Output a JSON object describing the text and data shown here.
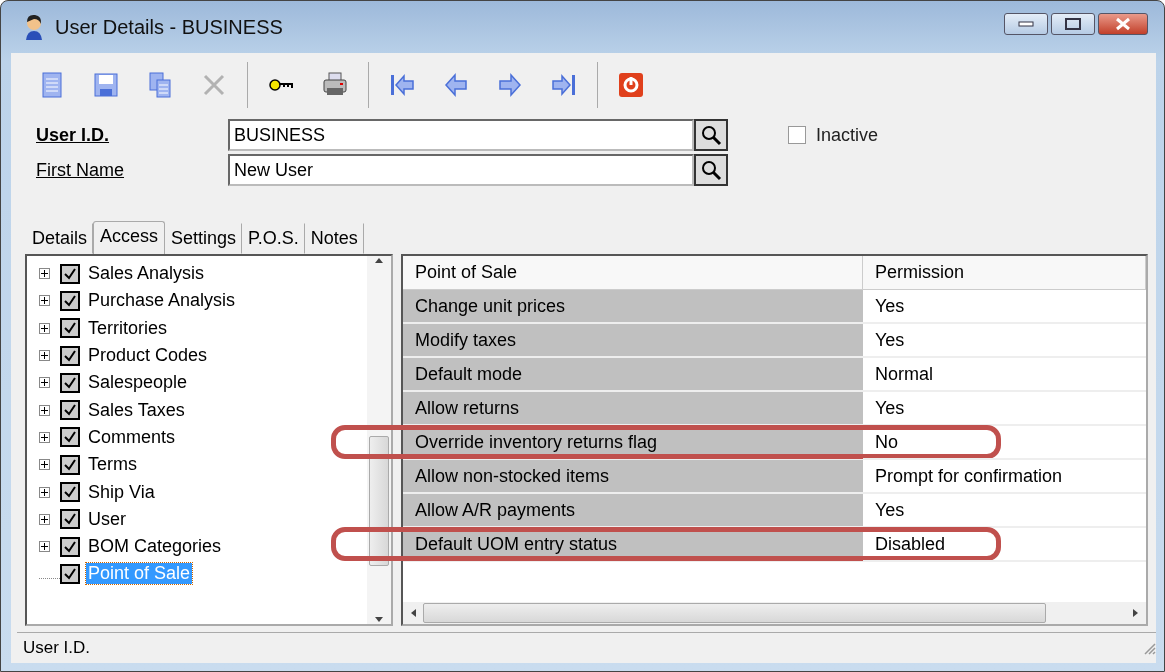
{
  "window": {
    "title": "User Details - BUSINESS"
  },
  "toolbar": [
    {
      "disabled": false
    },
    {
      "disabled": false
    },
    {
      "disabled": false
    },
    {
      "disabled": true
    },
    {
      "disabled": false
    },
    {
      "disabled": false
    },
    {
      "disabled": false
    },
    {
      "disabled": false
    },
    {
      "disabled": false
    },
    {
      "disabled": false
    },
    {
      "disabled": false
    }
  ],
  "fields": [
    {
      "label": "User I.D.",
      "value": "BUSINESS",
      "bold": true
    },
    {
      "label": "First Name",
      "value": "New User",
      "bold": false
    }
  ],
  "inactive": {
    "label": "Inactive",
    "checked": false
  },
  "tabs": [
    {
      "label": "Details",
      "selected": false
    },
    {
      "label": "Access",
      "selected": true
    },
    {
      "label": "Settings",
      "selected": false
    },
    {
      "label": "P.O.S.",
      "selected": false
    },
    {
      "label": "Notes",
      "selected": false
    }
  ],
  "tree": [
    {
      "label": "Sales Analysis",
      "checked": true,
      "expandable": true,
      "selected": false
    },
    {
      "label": "Purchase Analysis",
      "checked": true,
      "expandable": true,
      "selected": false
    },
    {
      "label": "Territories",
      "checked": true,
      "expandable": true,
      "selected": false
    },
    {
      "label": "Product Codes",
      "checked": true,
      "expandable": true,
      "selected": false
    },
    {
      "label": "Salespeople",
      "checked": true,
      "expandable": true,
      "selected": false
    },
    {
      "label": "Sales Taxes",
      "checked": true,
      "expandable": true,
      "selected": false
    },
    {
      "label": "Comments",
      "checked": true,
      "expandable": true,
      "selected": false
    },
    {
      "label": "Terms",
      "checked": true,
      "expandable": true,
      "selected": false
    },
    {
      "label": "Ship Via",
      "checked": true,
      "expandable": true,
      "selected": false
    },
    {
      "label": "User",
      "checked": true,
      "expandable": true,
      "selected": false
    },
    {
      "label": "BOM Categories",
      "checked": true,
      "expandable": true,
      "selected": false
    },
    {
      "label": "Point of Sale",
      "checked": true,
      "expandable": false,
      "selected": true
    }
  ],
  "grid": {
    "columns": [
      "Point of Sale",
      "Permission"
    ],
    "rows": [
      {
        "setting": "Change unit prices",
        "permission": "Yes",
        "highlighted": false
      },
      {
        "setting": "Modify taxes",
        "permission": "Yes",
        "highlighted": false
      },
      {
        "setting": "Default mode",
        "permission": "Normal",
        "highlighted": false
      },
      {
        "setting": "Allow returns",
        "permission": "Yes",
        "highlighted": false
      },
      {
        "setting": "Override inventory returns flag",
        "permission": "No",
        "highlighted": true
      },
      {
        "setting": "Allow non-stocked items",
        "permission": "Prompt for confirmation",
        "highlighted": false
      },
      {
        "setting": "Allow A/R payments",
        "permission": "Yes",
        "highlighted": false
      },
      {
        "setting": "Default UOM entry status",
        "permission": "Disabled",
        "highlighted": true
      }
    ]
  },
  "status_bar": {
    "text": "User I.D."
  }
}
